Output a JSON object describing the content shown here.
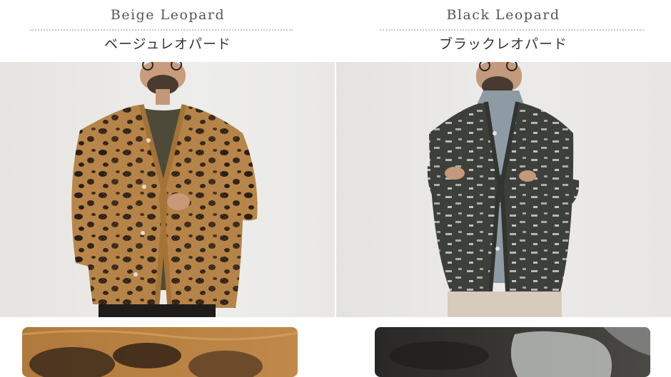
{
  "products": [
    {
      "title_en": "Beige Leopard",
      "title_ja": "ベージュレオパード",
      "colors": {
        "knit": "#b88546",
        "spot": "#2e2118",
        "inner": "#4e4a3a"
      }
    },
    {
      "title_en": "Black Leopard",
      "title_ja": "ブラックレオパード",
      "colors": {
        "knit": "#3f413c",
        "spot": "#b9bcb7",
        "inner": "#8f9ca5"
      }
    }
  ]
}
